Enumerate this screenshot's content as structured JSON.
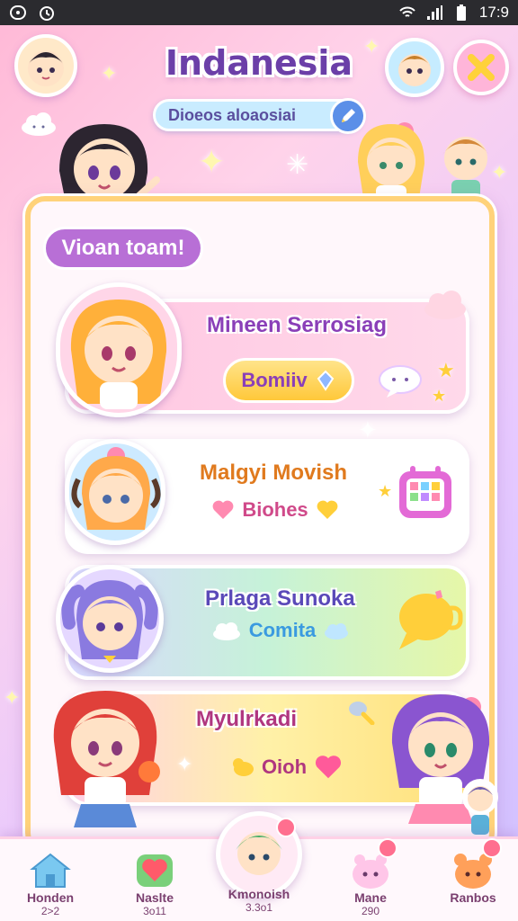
{
  "status_bar": {
    "time": "17:9",
    "icons": [
      "notification-icon",
      "alarm-icon",
      "wifi-icon",
      "signal-icon",
      "battery-icon"
    ]
  },
  "header": {
    "title": "Indanesia",
    "search_placeholder": "Dioeos aloaosiai"
  },
  "section": {
    "label": "Vioan toam!"
  },
  "cards": [
    {
      "title": "Mineen Serrosiag",
      "chip": "Bomiiv",
      "title_color": "#8a3fb8"
    },
    {
      "title": "Malgyi Movish",
      "chip": "Biohes",
      "title_color": "#e07a1e"
    },
    {
      "title": "Prlaga Sunoka",
      "chip": "Comita",
      "title_color": "#5a49b8"
    },
    {
      "title": "Myulrkadi",
      "chip": "Oioh",
      "title_color": "#b0367f"
    }
  ],
  "bottom_nav": [
    {
      "label": "Honden",
      "sub": "2>2",
      "icon": "home-icon"
    },
    {
      "label": "Naslte",
      "sub": "3o11",
      "icon": "heart-icon"
    },
    {
      "label": "Kmonoish",
      "sub": "3.3o1",
      "icon": "profile-icon"
    },
    {
      "label": "Mane",
      "sub": "290",
      "icon": "pet-icon"
    },
    {
      "label": "Ranbos",
      "sub": "",
      "icon": "bear-icon"
    }
  ],
  "colors": {
    "accent_purple": "#b86fd6",
    "panel_border": "#ffd27a",
    "title": "#6b3fa8",
    "card1_bg": "#ffc0dc",
    "card2_bg": "#ffffff",
    "card3_bg": "#c9f0d6",
    "card4_bg": "#fff1a8"
  }
}
